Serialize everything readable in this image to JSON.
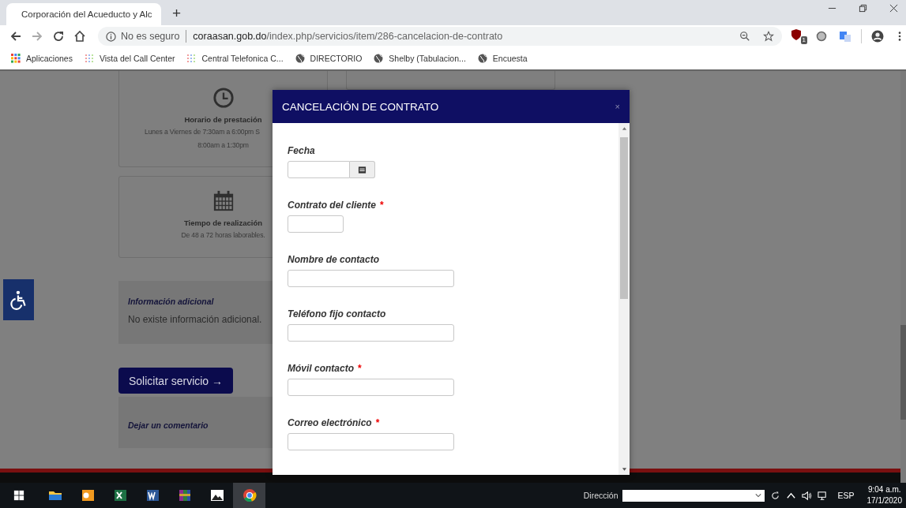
{
  "browser": {
    "tab_title": "Corporación del Acueducto y Alc",
    "new_tab": "+",
    "url_security": "No es seguro",
    "url_host": "coraasan.gob.do",
    "url_path": "/index.php/servicios/item/286-cancelacion-de-contrato",
    "extension_badge": "1",
    "bookmarks": [
      {
        "label": "Aplicaciones",
        "kind": "apps"
      },
      {
        "label": "Vista del Call Center",
        "kind": "dots"
      },
      {
        "label": "Central Telefonica C...",
        "kind": "dots"
      },
      {
        "label": "DIRECTORIO",
        "kind": "globe"
      },
      {
        "label": "Shelby (Tabulacion...",
        "kind": "globe"
      },
      {
        "label": "Encuesta",
        "kind": "globe"
      }
    ]
  },
  "page": {
    "cards": [
      {
        "kind": "clock",
        "title": "Horario de prestación",
        "lines": [
          "Lunes a Viernes de 7:30am a 6:00pm S",
          "8:00am a 1:30pm"
        ]
      },
      {
        "kind": "calendar",
        "title": "Tiempo de realización",
        "lines": [
          "De 48 a 72 horas laborables."
        ]
      }
    ],
    "info_title": "Información adicional",
    "info_text": "No existe información adicional.",
    "request_button": "Solicitar servicio →",
    "comment_title": "Dejar un comentario"
  },
  "modal": {
    "title": "CANCELACIÓN DE CONTRATO",
    "close": "×",
    "fields": [
      {
        "label": "Fecha",
        "required": false,
        "kind": "date"
      },
      {
        "label": "Contrato del cliente",
        "required": true,
        "kind": "short"
      },
      {
        "label": "Nombre de contacto",
        "required": false,
        "kind": "text"
      },
      {
        "label": "Teléfono fijo contacto",
        "required": false,
        "kind": "text"
      },
      {
        "label": "Móvil contacto",
        "required": true,
        "kind": "text"
      },
      {
        "label": "Correo electrónico",
        "required": true,
        "kind": "text"
      }
    ],
    "required_mark": "*"
  },
  "taskbar": {
    "apps": [
      {
        "kind": "folder",
        "selected": false
      },
      {
        "kind": "outlook",
        "selected": false
      },
      {
        "kind": "excel",
        "selected": false
      },
      {
        "kind": "word",
        "selected": false
      },
      {
        "kind": "archive",
        "selected": false
      },
      {
        "kind": "photos",
        "selected": false
      },
      {
        "kind": "chrome",
        "selected": true
      }
    ],
    "address_label": "Dirección",
    "language": "ESP",
    "time": "9:04 a.m.",
    "date": "17/1/2020"
  }
}
